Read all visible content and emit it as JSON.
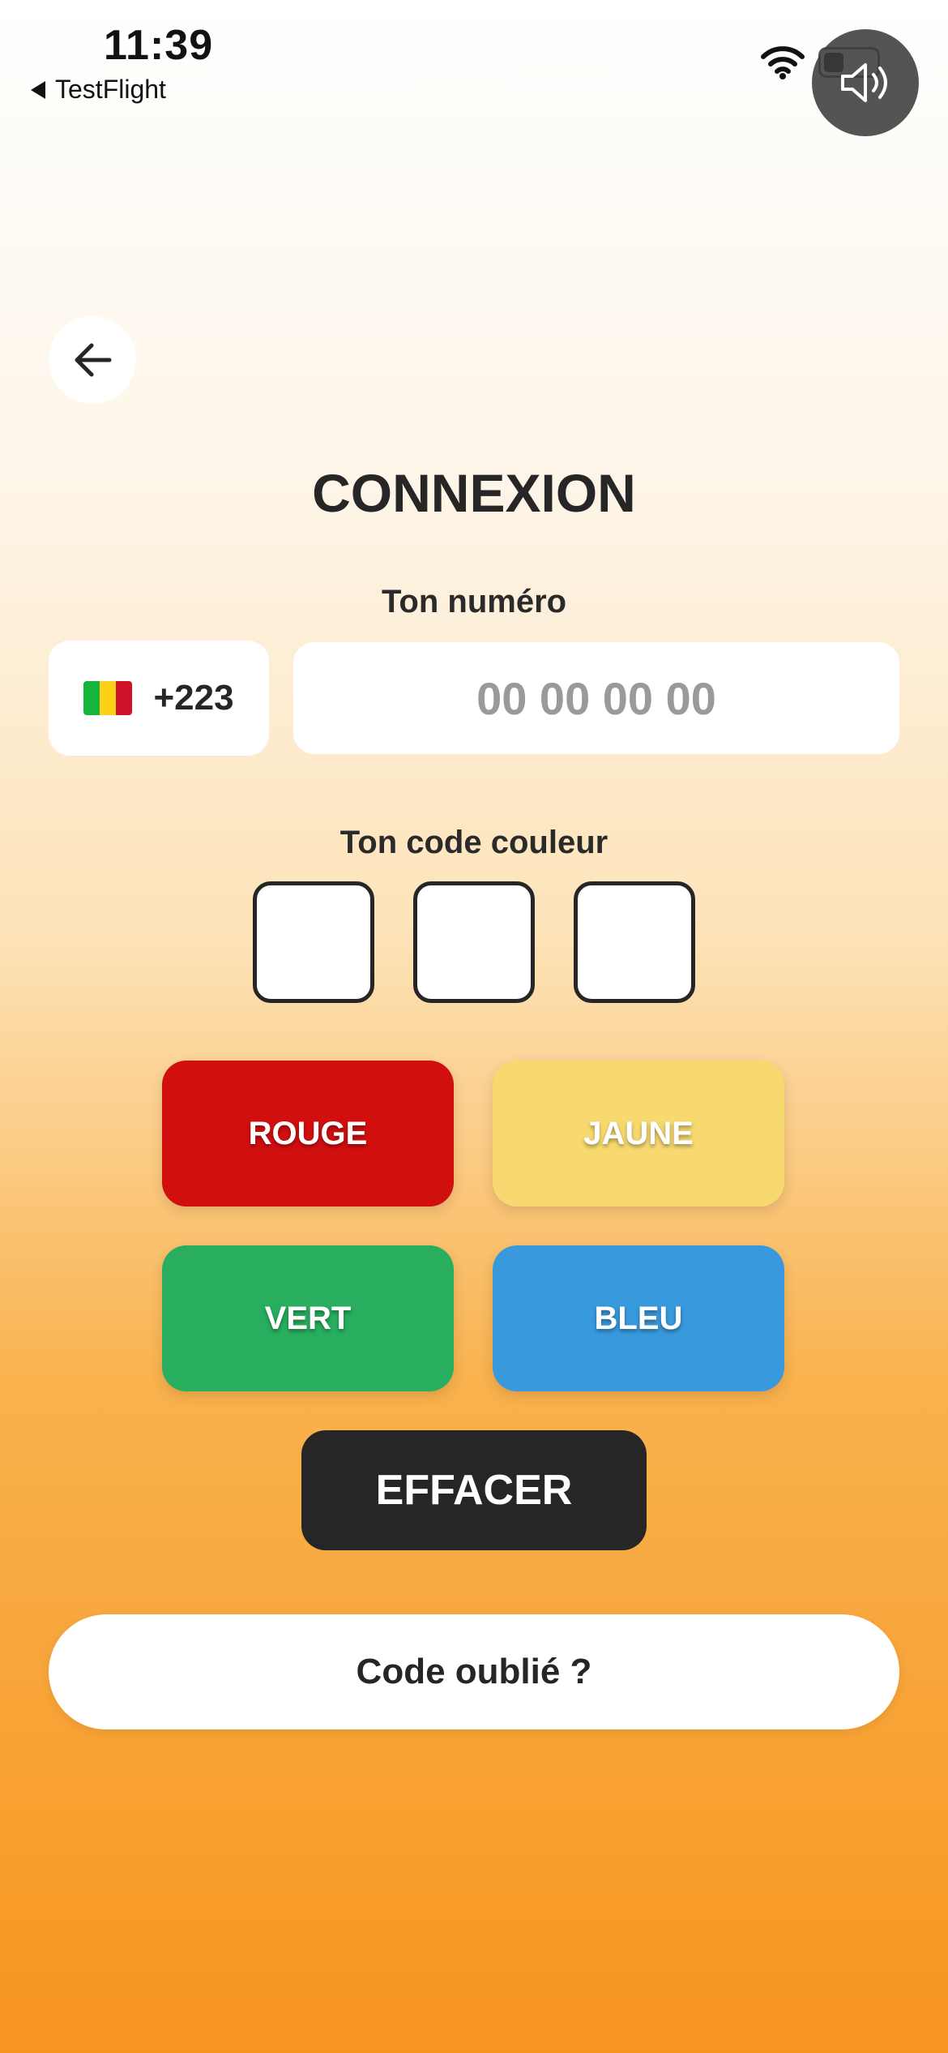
{
  "status_bar": {
    "time": "11:39",
    "back_app_label": "TestFlight",
    "wifi_icon": "wifi-icon",
    "battery_icon": "battery-icon"
  },
  "sound_button_icon": "speaker-icon",
  "nav": {
    "back_icon": "arrow-left-icon"
  },
  "title": "CONNEXION",
  "phone": {
    "label": "Ton numéro",
    "country_flag": "mali-flag",
    "country_code": "+223",
    "value": "",
    "placeholder": "00 00 00 00"
  },
  "color_code": {
    "label": "Ton code couleur",
    "slots": [
      "",
      "",
      ""
    ]
  },
  "color_buttons": {
    "red": {
      "label": "ROUGE",
      "color": "#d20f0f"
    },
    "yellow": {
      "label": "JAUNE",
      "color": "#f7d970"
    },
    "green": {
      "label": "VERT",
      "color": "#28ae5e"
    },
    "blue": {
      "label": "BLEU",
      "color": "#3899dc"
    }
  },
  "clear_button": {
    "label": "EFFACER"
  },
  "forgot_button": {
    "label": "Code oublié ?"
  },
  "colors": {
    "accent_orange": "#f7951f",
    "text_dark": "#262626"
  }
}
